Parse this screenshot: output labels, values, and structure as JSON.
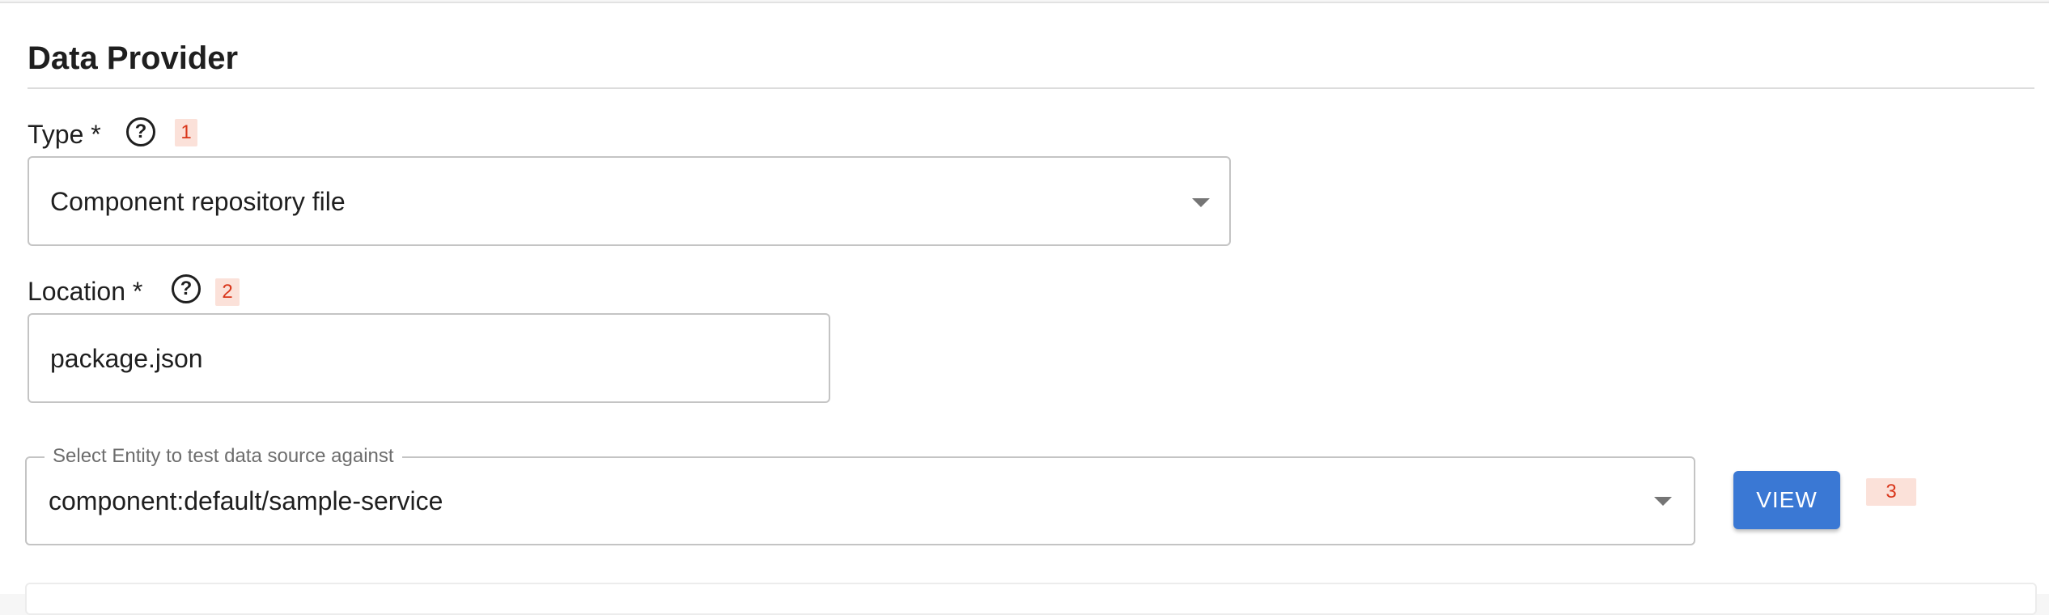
{
  "section": {
    "title": "Data Provider"
  },
  "type_field": {
    "label": "Type *",
    "help_icon": "help-circle-icon",
    "marker": "1",
    "value": "Component repository file",
    "caret_icon": "caret-down-icon"
  },
  "location_field": {
    "label": "Location *",
    "help_icon": "help-circle-icon",
    "marker": "2",
    "value": "package.json"
  },
  "entity_field": {
    "legend": "Select Entity to test data source against",
    "value": "component:default/sample-service",
    "caret_icon": "caret-down-icon"
  },
  "view_button": {
    "label": "VIEW",
    "marker": "3",
    "color": "#3a78d4"
  },
  "colors": {
    "marker_background": "#fbe1d9",
    "marker_text": "#d9361b"
  }
}
